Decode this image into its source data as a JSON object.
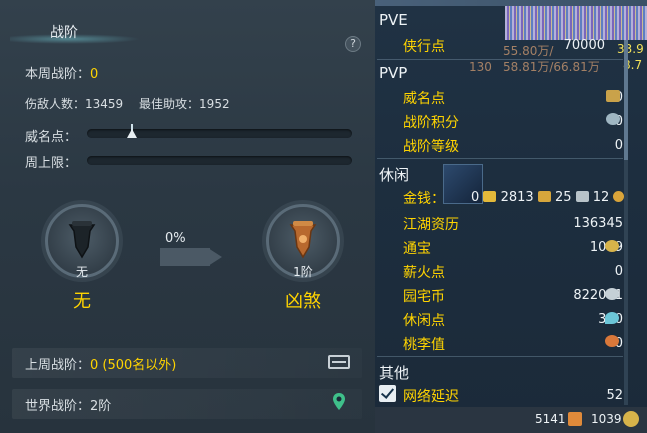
{
  "left": {
    "title": "战阶",
    "help": "?",
    "weekly_rank_label": "本周战阶：",
    "weekly_rank_value": "0",
    "kills_label": "伤敌人数：",
    "kills_value": "13459",
    "best_assist_label": "最佳助攻：",
    "best_assist_value": "1952",
    "prestige_label": "威名点：",
    "weekly_cap_label": "周上限：",
    "current_medal_label": "无",
    "current_rank_name": "无",
    "progress_percent": "0%",
    "next_medal_label": "1阶",
    "next_rank_name": "凶煞",
    "last_week_label": "上周战阶：",
    "last_week_value": "0 (500名以外)",
    "world_label": "世界战阶：",
    "world_value": "2阶",
    "prestige_fill": 0.17,
    "weekly_cap_fill": 0.0
  },
  "right": {
    "pve_header": "PVE",
    "pvp_header": "PVP",
    "leisure_header": "休闲",
    "other_header": "其他",
    "ghost": {
      "a": "55.80万/",
      "b": "58.81万/66.81万",
      "c": "130",
      "d": "33.9",
      "e": "8.7"
    },
    "rows": {
      "xiaxing": {
        "label": "侠行点",
        "value": "70000"
      },
      "weiming": {
        "label": "威名点",
        "value": "0"
      },
      "jifen": {
        "label": "战阶积分",
        "value": "0"
      },
      "dengji": {
        "label": "战阶等级",
        "value": "0"
      },
      "jinqian": {
        "label": "金钱：",
        "v1": "0",
        "v2": "2813",
        "v3": "25",
        "v4": "12"
      },
      "jianghu": {
        "label": "江湖资历",
        "value": "136345"
      },
      "tongbao": {
        "label": "通宝",
        "value": "1039"
      },
      "xinhuo": {
        "label": "薪火点",
        "value": "0"
      },
      "yuanzhai": {
        "label": "园宅币",
        "value": "822061"
      },
      "xiuxian": {
        "label": "休闲点",
        "value": "300"
      },
      "taoli": {
        "label": "桃李值",
        "value": "0"
      },
      "wangluo": {
        "label": "网络延迟",
        "value": "52"
      }
    },
    "footer": {
      "v1": "5141",
      "v2": "1039"
    }
  }
}
